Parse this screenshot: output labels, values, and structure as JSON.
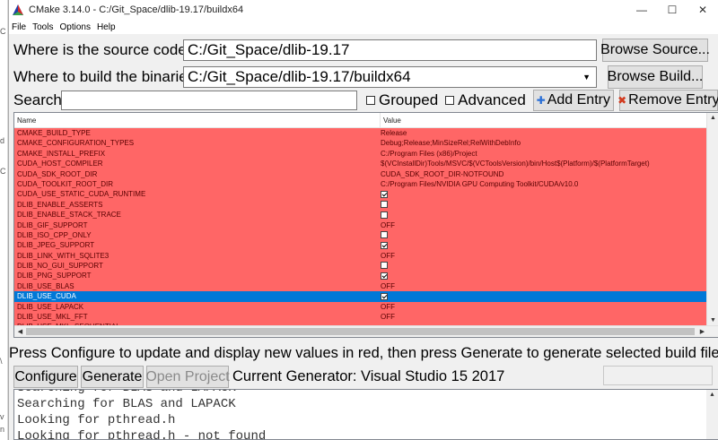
{
  "window": {
    "title": "CMake 3.14.0 - C:/Git_Space/dlib-19.17/buildx64",
    "minimize": "—",
    "maximize": "☐",
    "close": "✕"
  },
  "edge": [
    "C",
    "d",
    "C",
    "\\",
    "v",
    "n"
  ],
  "menu": [
    "File",
    "Tools",
    "Options",
    "Help"
  ],
  "source": {
    "label": "Where is the source code:",
    "value": "C:/Git_Space/dlib-19.17",
    "browse": "Browse Source..."
  },
  "build": {
    "label": "Where to build the binaries:",
    "value": "C:/Git_Space/dlib-19.17/buildx64",
    "browse": "Browse Build..."
  },
  "search": {
    "label": "Search:",
    "value": ""
  },
  "options": {
    "grouped": "Grouped",
    "advanced": "Advanced",
    "add": "Add Entry",
    "remove": "Remove Entry"
  },
  "table": {
    "headers": {
      "name": "Name",
      "value": "Value"
    },
    "rows": [
      {
        "name": "CMAKE_BUILD_TYPE",
        "value": "Release",
        "kind": "text"
      },
      {
        "name": "CMAKE_CONFIGURATION_TYPES",
        "value": "Debug;Release;MinSizeRel;RelWithDebInfo",
        "kind": "text"
      },
      {
        "name": "CMAKE_INSTALL_PREFIX",
        "value": "C:/Program Files (x86)/Project",
        "kind": "text"
      },
      {
        "name": "CUDA_HOST_COMPILER",
        "value": "$(VCInstallDir)Tools/MSVC/$(VCToolsVersion)/bin/Host$(Platform)/$(PlatformTarget)",
        "kind": "text"
      },
      {
        "name": "CUDA_SDK_ROOT_DIR",
        "value": "CUDA_SDK_ROOT_DIR-NOTFOUND",
        "kind": "text"
      },
      {
        "name": "CUDA_TOOLKIT_ROOT_DIR",
        "value": "C:/Program Files/NVIDIA GPU Computing Toolkit/CUDA/v10.0",
        "kind": "text"
      },
      {
        "name": "CUDA_USE_STATIC_CUDA_RUNTIME",
        "value": "",
        "kind": "check",
        "checked": true
      },
      {
        "name": "DLIB_ENABLE_ASSERTS",
        "value": "",
        "kind": "check",
        "checked": false
      },
      {
        "name": "DLIB_ENABLE_STACK_TRACE",
        "value": "",
        "kind": "check",
        "checked": false
      },
      {
        "name": "DLIB_GIF_SUPPORT",
        "value": "OFF",
        "kind": "text"
      },
      {
        "name": "DLIB_ISO_CPP_ONLY",
        "value": "",
        "kind": "check",
        "checked": false
      },
      {
        "name": "DLIB_JPEG_SUPPORT",
        "value": "",
        "kind": "check",
        "checked": true
      },
      {
        "name": "DLIB_LINK_WITH_SQLITE3",
        "value": "OFF",
        "kind": "text"
      },
      {
        "name": "DLIB_NO_GUI_SUPPORT",
        "value": "",
        "kind": "check",
        "checked": false
      },
      {
        "name": "DLIB_PNG_SUPPORT",
        "value": "",
        "kind": "check",
        "checked": true
      },
      {
        "name": "DLIB_USE_BLAS",
        "value": "OFF",
        "kind": "text"
      },
      {
        "name": "DLIB_USE_CUDA",
        "value": "",
        "kind": "check",
        "checked": true,
        "selected": true
      },
      {
        "name": "DLIB_USE_LAPACK",
        "value": "OFF",
        "kind": "text"
      },
      {
        "name": "DLIB_USE_MKL_FFT",
        "value": "OFF",
        "kind": "text"
      },
      {
        "name": "DLIB_USE_MKL_SEQUENTIAL",
        "value": "",
        "kind": "text"
      }
    ]
  },
  "status_text": "Press Configure to update and display new values in red, then press Generate to generate selected build files.",
  "actions": {
    "configure": "Configure",
    "generate": "Generate",
    "open_project": "Open Project",
    "generator": "Current Generator: Visual Studio 15 2017"
  },
  "output": [
    "Searching for BLAS and LAPACK",
    "Searching for BLAS and LAPACK",
    "Looking for pthread.h",
    "Looking for pthread.h - not found"
  ],
  "colors": {
    "changed_row": "#ff6666",
    "selected_row": "#0078d7"
  }
}
